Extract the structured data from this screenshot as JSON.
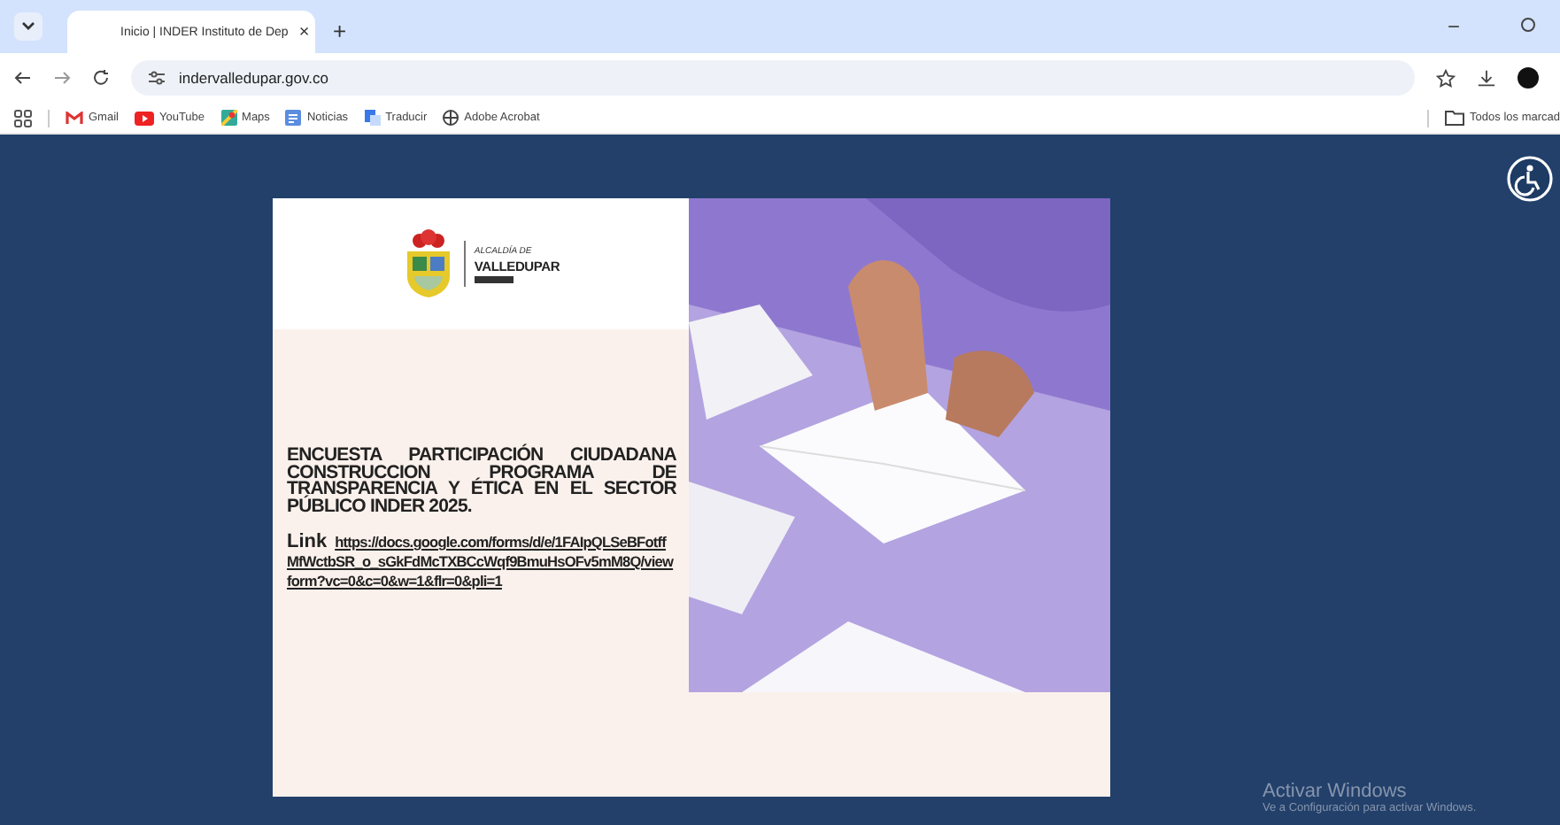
{
  "tab": {
    "title": "Inicio | INDER Instituto de Dep",
    "close": "×",
    "new_tab": "+"
  },
  "window_controls": {
    "minimize": "−"
  },
  "address_bar": {
    "url": "indervalledupar.gov.co"
  },
  "bookmarks": [
    {
      "label": "Gmail",
      "kind": "gmail"
    },
    {
      "label": "YouTube",
      "kind": "youtube"
    },
    {
      "label": "Maps",
      "kind": "maps"
    },
    {
      "label": "Noticias",
      "kind": "news"
    },
    {
      "label": "Traducir",
      "kind": "translate"
    },
    {
      "label": "Adobe Acrobat",
      "kind": "globe"
    }
  ],
  "all_bookmarks": "Todos los marcad",
  "popup": {
    "logo": {
      "line1": "ALCALDÍA DE",
      "line2": "VALLEDUPAR"
    },
    "heading": "ENCUESTA PARTICIPACIÓN CIUDADANA CONSTRUCCION PROGRAMA DE TRANSPARENCIA Y ÉTICA EN EL SECTOR PÚBLICO INDER 2025.",
    "link_label": "Link",
    "link_url": "https://docs.google.com/forms/d/e/1FAIpQLSeBFotffMfWctbSR_o_sGkFdMcTXBCcWqf9BmuHsOFv5mM8Q/viewform?vc=0&c=0&w=1&flr=0&pli=1"
  },
  "windows_notice": {
    "title": "Activar Windows",
    "text": "Ve a Configuración para activar Windows."
  }
}
